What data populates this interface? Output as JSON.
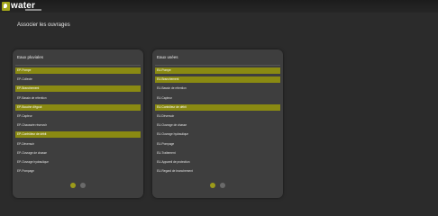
{
  "app": {
    "logo_text": "water"
  },
  "page": {
    "title": "Associer les ouvrages"
  },
  "colors": {
    "accent": "#8a8a12",
    "background": "#2b2b2b",
    "panel": "#3e3e3e"
  },
  "panels": [
    {
      "title": "Eaux pluviales",
      "items": [
        {
          "label": "EP-Pompe",
          "selected": true
        },
        {
          "label": "EP-Collecte",
          "selected": false
        },
        {
          "label": "EP-Branchement",
          "selected": true
        },
        {
          "label": "EP-Bassin de rétention",
          "selected": false
        },
        {
          "label": "EP-Bouche d'égout",
          "selected": true
        },
        {
          "label": "EP-Capteur",
          "selected": false
        },
        {
          "label": "EP-Chaussée réservoir",
          "selected": false
        },
        {
          "label": "EP-Contrôleur de débit",
          "selected": true
        },
        {
          "label": "EP-Déversoir",
          "selected": false
        },
        {
          "label": "EP-Ouvrage de chasse",
          "selected": false
        },
        {
          "label": "EP-Ouvrage hydraulique",
          "selected": false
        },
        {
          "label": "EP-Pompage",
          "selected": false
        }
      ],
      "pagination": {
        "pages": 2,
        "active": 1
      }
    },
    {
      "title": "Eaux usées",
      "items": [
        {
          "label": "EU-Pompe",
          "selected": true
        },
        {
          "label": "EU-Branchement",
          "selected": true
        },
        {
          "label": "EU-Bassin de rétention",
          "selected": false
        },
        {
          "label": "EU-Capteur",
          "selected": false
        },
        {
          "label": "EU-Contrôleur de débit",
          "selected": true
        },
        {
          "label": "EU-Déversoir",
          "selected": false
        },
        {
          "label": "EU-Ouvrage de chasse",
          "selected": false
        },
        {
          "label": "EU-Ouvrage hydraulique",
          "selected": false
        },
        {
          "label": "EU-Pompage",
          "selected": false
        },
        {
          "label": "EU-Traitement",
          "selected": false
        },
        {
          "label": "EU-Appareil de protection",
          "selected": false
        },
        {
          "label": "EU-Regard de branchement",
          "selected": false
        }
      ],
      "pagination": {
        "pages": 2,
        "active": 1
      }
    }
  ]
}
